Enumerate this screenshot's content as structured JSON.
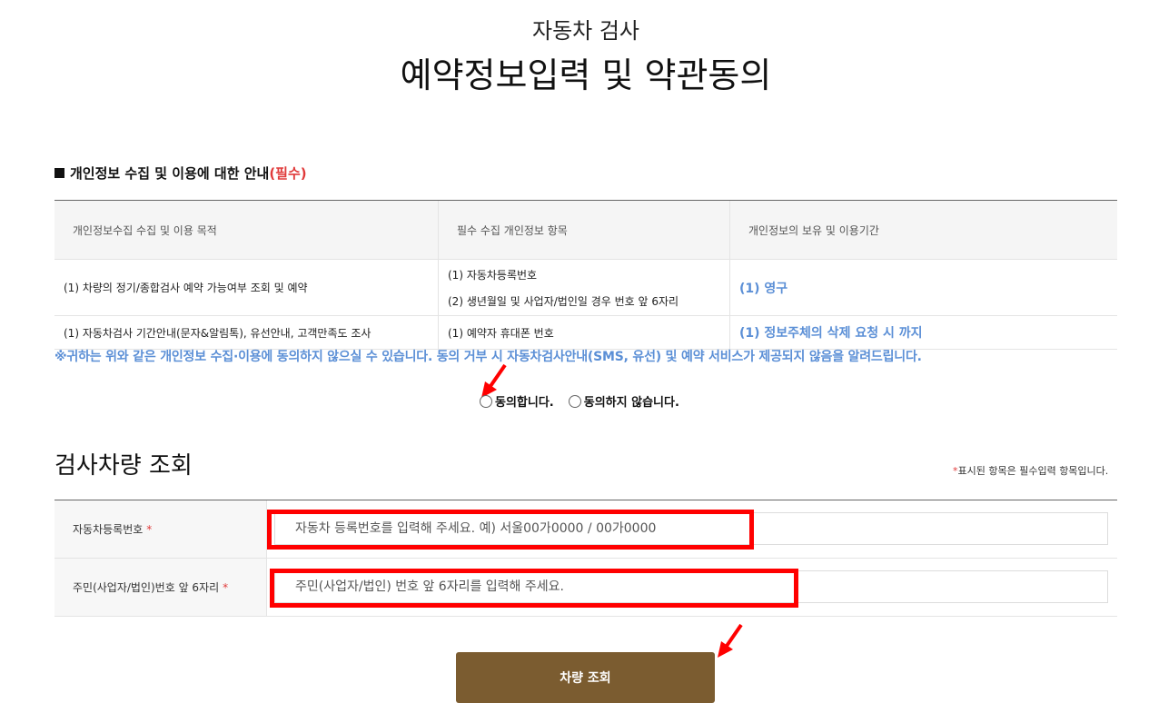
{
  "header": {
    "subtitle": "자동차 검사",
    "title": "예약정보입력 및 약관동의"
  },
  "privacy": {
    "section_title": "개인정보 수집 및 이용에 대한 안내",
    "section_required": "(필수)",
    "columns": [
      "개인정보수집 수집 및 이용 목적",
      "필수 수집 개인정보 항목",
      "개인정보의 보유 및 이용기간"
    ],
    "rows": [
      {
        "purpose": "(1) 차량의 정기/종합검사 예약 가능여부 조회 및 예약",
        "items": [
          "(1) 자동차등록번호",
          "(2) 생년월일 및 사업자/법인일 경우 번호 앞 6자리"
        ],
        "period": "(1) 영구"
      },
      {
        "purpose": "(1) 자동차검사 기간안내(문자&알림톡), 유선안내, 고객만족도 조사",
        "items": [
          "(1) 예약자 휴대폰 번호"
        ],
        "period": "(1) 정보주체의 삭제 요청 시 까지"
      }
    ],
    "notice": "※귀하는 위와 같은 개인정보 수집·이용에 동의하지 않으실 수 있습니다. 동의 거부 시 자동차검사안내(SMS, 유선) 및 예약 서비스가 제공되지 않음을 알려드립니다.",
    "agree_label": "동의합니다.",
    "disagree_label": "동의하지 않습니다."
  },
  "lookup": {
    "title": "검사차량 조회",
    "required_note_star": "*",
    "required_note": "표시된 항목은 필수입력 항목입니다.",
    "fields": [
      {
        "label": "자동차등록번호",
        "star": "*",
        "value": "",
        "placeholder": "자동차 등록번호를 입력해 주세요. 예) 서울00가0000 / 00가0000"
      },
      {
        "label": "주민(사업자/법인)번호 앞 6자리",
        "star": "*",
        "value": "",
        "placeholder": "주민(사업자/법인) 번호 앞 6자리를 입력해 주세요."
      }
    ],
    "submit_label": "차량 조회"
  },
  "colors": {
    "accent_blue": "#5b8fd6",
    "required_red": "#e03a3a",
    "button_brown": "#7b5c30",
    "highlight_red": "#ff0000"
  },
  "icons": [
    "square-bullet-icon",
    "radio-icon",
    "red-arrow-icon"
  ]
}
